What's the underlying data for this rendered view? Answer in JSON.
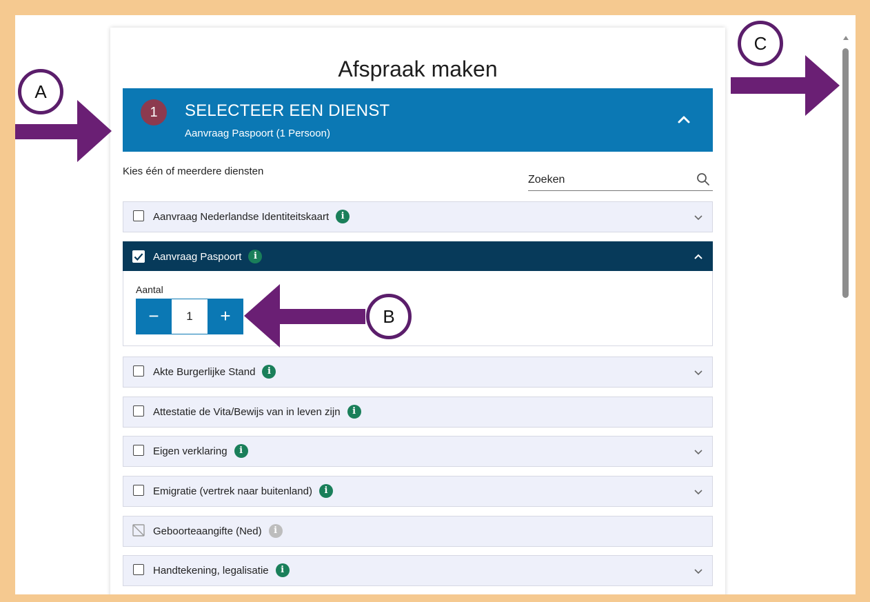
{
  "page": {
    "title": "Afspraak maken",
    "frame_color": "#f5c990",
    "accent": "#0b78b4",
    "selected_row_color": "#073a5a",
    "annotation_color": "#5b1e6b"
  },
  "step": {
    "number": "1",
    "title": "SELECTEER EEN DIENST",
    "subtitle": "Aanvraag Paspoort (1 Persoon)",
    "toggle_icon": "chevron-up-icon"
  },
  "intro": "Kies één of meerdere diensten",
  "search": {
    "placeholder": "Zoeken",
    "icon": "search-icon"
  },
  "services": [
    {
      "label": "Aanvraag Nederlandse Identiteitskaart",
      "checked": false,
      "info": "i",
      "expandable": true
    },
    {
      "label": "Aanvraag Paspoort",
      "checked": true,
      "info": "i",
      "expandable": true
    },
    {
      "label": "Akte Burgerlijke Stand",
      "checked": false,
      "info": "i",
      "expandable": true
    },
    {
      "label": "Attestatie de Vita/Bewijs van in leven zijn",
      "checked": false,
      "info": "i",
      "expandable": false
    },
    {
      "label": "Eigen verklaring",
      "checked": false,
      "info": "i",
      "expandable": true
    },
    {
      "label": "Emigratie (vertrek naar buitenland)",
      "checked": false,
      "info": "i",
      "expandable": true
    },
    {
      "label": "Geboorteaangifte (Ned)",
      "checked": false,
      "disabled": true,
      "info": "i",
      "expandable": false
    },
    {
      "label": "Handtekening, legalisatie",
      "checked": false,
      "info": "i",
      "expandable": true
    }
  ],
  "quantity": {
    "label": "Aantal",
    "value": "1",
    "minus": "−",
    "plus": "+"
  },
  "annotations": {
    "a": "A",
    "b": "B",
    "c": "C"
  }
}
